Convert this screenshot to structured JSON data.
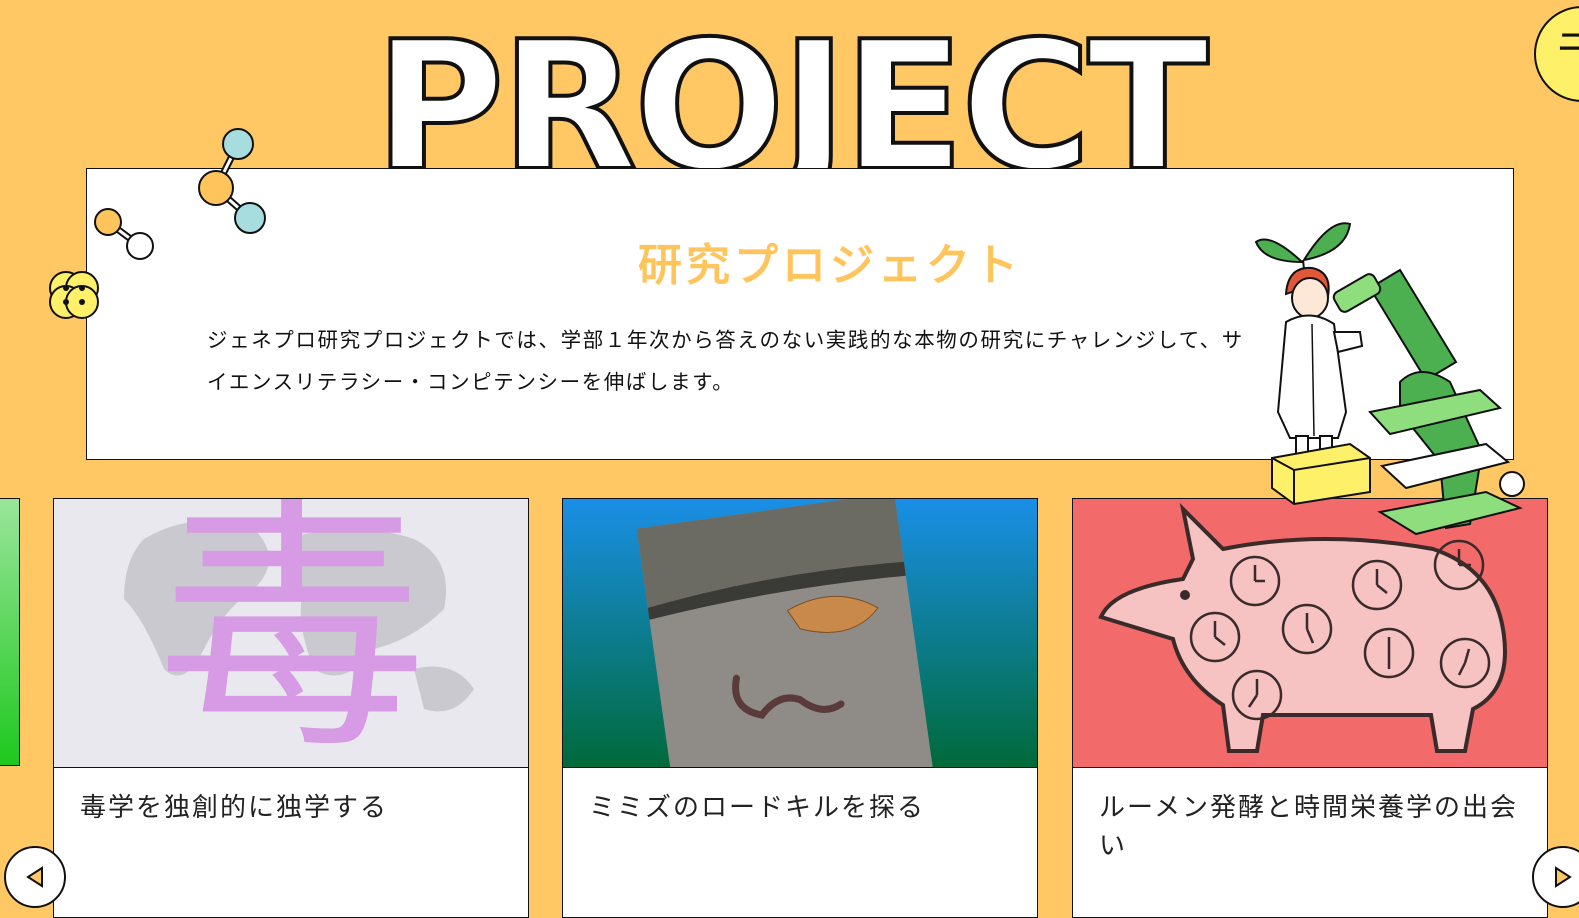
{
  "header": {
    "title": "PROJECT",
    "corner_badge": "ニ"
  },
  "intro": {
    "heading": "研究プロジェクト",
    "text": "ジェネプロ研究プロジェクトでは、学部１年次から答えのない実践的な本物の研究にチャレンジして、サイエンスリテラシー・コンピテンシーを伸ばします。"
  },
  "cards": [
    {
      "title": "毒学を独創的に独学する",
      "thumb_glyph": "毒"
    },
    {
      "title": "ミミズのロードキルを探る"
    },
    {
      "title": "ルーメン発酵と時間栄養学の出会い"
    }
  ],
  "colors": {
    "background": "#ffc864",
    "heading_accent": "#ffc55c",
    "card1_bg": "#e9e8ee",
    "card1_glyph": "#d79ae4",
    "card3_bg": "#f26a6a"
  }
}
